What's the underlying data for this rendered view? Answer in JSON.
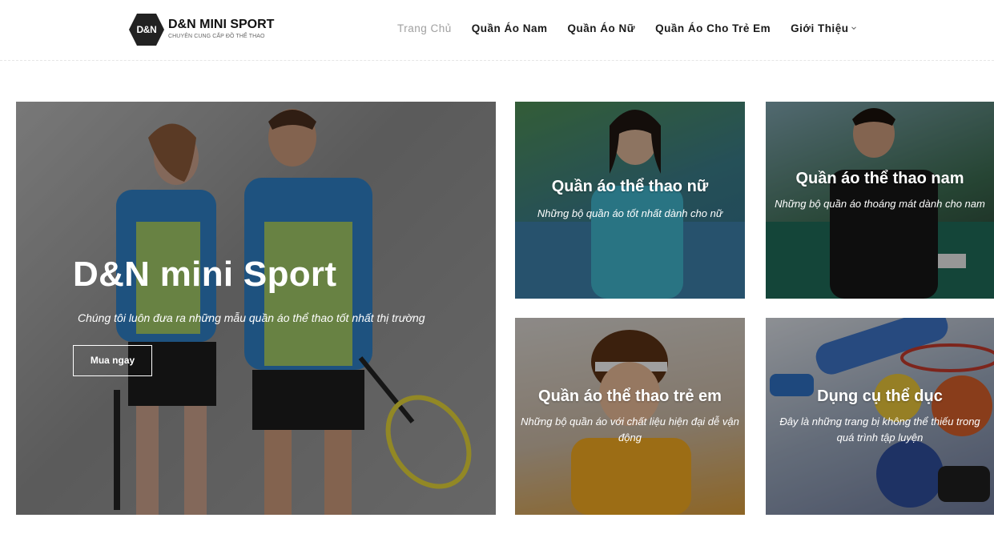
{
  "header": {
    "logo": {
      "badge": "D&N",
      "name": "D&N MINI SPORT",
      "tagline": "CHUYÊN CUNG CẤP ĐỒ THỂ THAO"
    },
    "nav": [
      {
        "label": "Trang Chủ",
        "active": true
      },
      {
        "label": "Quần Áo Nam",
        "active": false
      },
      {
        "label": "Quần Áo Nữ",
        "active": false
      },
      {
        "label": "Quần Áo Cho Trẻ Em",
        "active": false
      },
      {
        "label": "Giới Thiệu",
        "active": false,
        "has_dropdown": true
      }
    ]
  },
  "hero": {
    "title": "D&N mini Sport",
    "subtitle": "Chúng tôi luôn đưa ra những mẫu quần áo thể thao tốt nhất thị trường",
    "cta": "Mua ngay"
  },
  "tiles": {
    "women": {
      "title": "Quần áo thể thao nữ",
      "desc": "Những bộ quần áo tốt nhất dành cho nữ"
    },
    "men": {
      "title": "Quần áo thể thao nam",
      "desc": "Những bộ quần áo thoáng mát dành cho nam"
    },
    "kids": {
      "title": "Quần áo thể thao trẻ em",
      "desc": "Những bộ quần áo với chất liệu hiện đại dễ vận động"
    },
    "gear": {
      "title": "Dụng cụ thể dục",
      "desc": "Đây là những trang bị không thể thiếu trong quá trình tập luyện"
    }
  },
  "colors": {
    "nav_active": "#a0a0a0",
    "text_dark": "#1a1a1a",
    "logo_hex": "#222222"
  }
}
